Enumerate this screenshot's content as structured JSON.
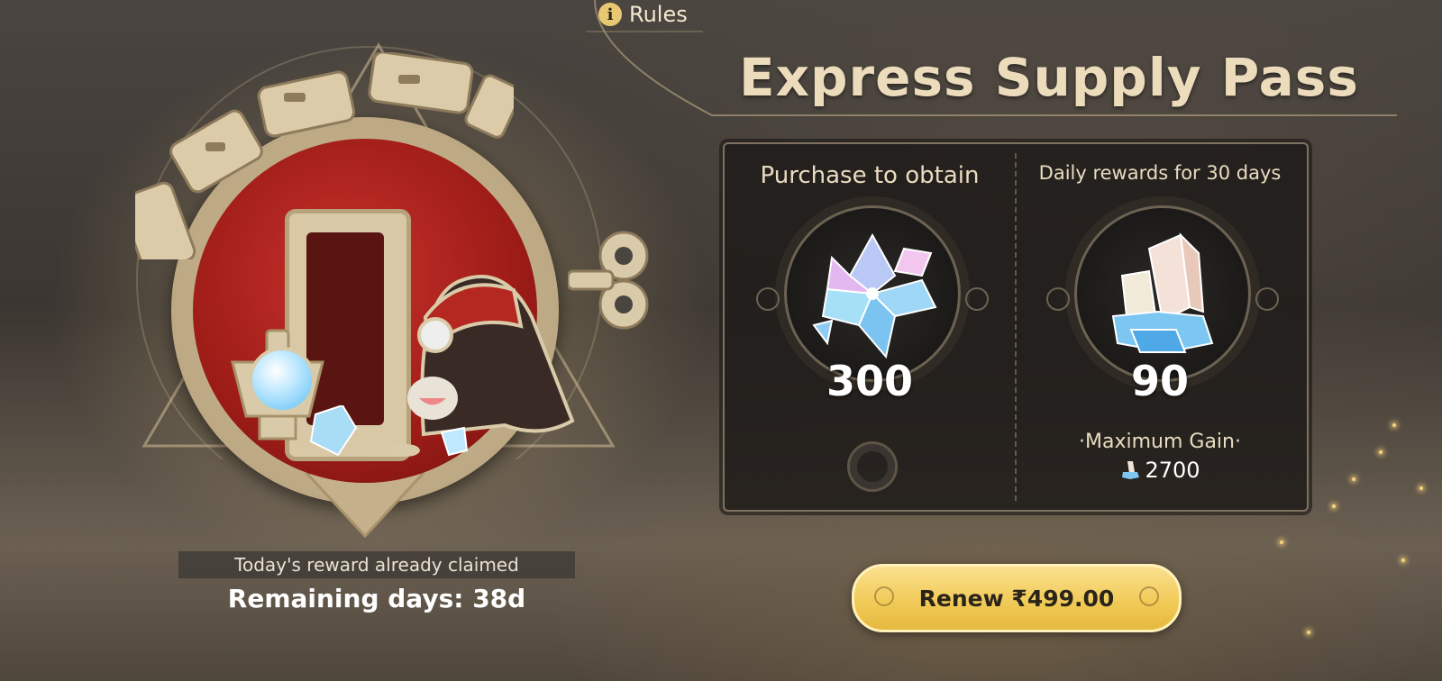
{
  "rules": {
    "icon": "info-icon",
    "label": "Rules"
  },
  "title": "Express Supply Pass",
  "rewards": {
    "purchase": {
      "heading": "Purchase to obtain",
      "amount": "300",
      "icon": "oneiric-shard-icon"
    },
    "daily": {
      "heading": "Daily rewards for 30 days",
      "amount": "90",
      "icon": "stellar-jade-icon",
      "max_label": "·Maximum Gain·",
      "max_value": "2700",
      "max_icon": "stellar-jade-small-icon"
    }
  },
  "status": {
    "claimed_text": "Today's reward already claimed",
    "remaining_text": "Remaining days: 38d"
  },
  "renew_button": "Renew ₹499.00",
  "colors": {
    "accent_gold": "#f1cb59",
    "seal_red": "#c8312b",
    "title_text": "#ecdcbc"
  }
}
